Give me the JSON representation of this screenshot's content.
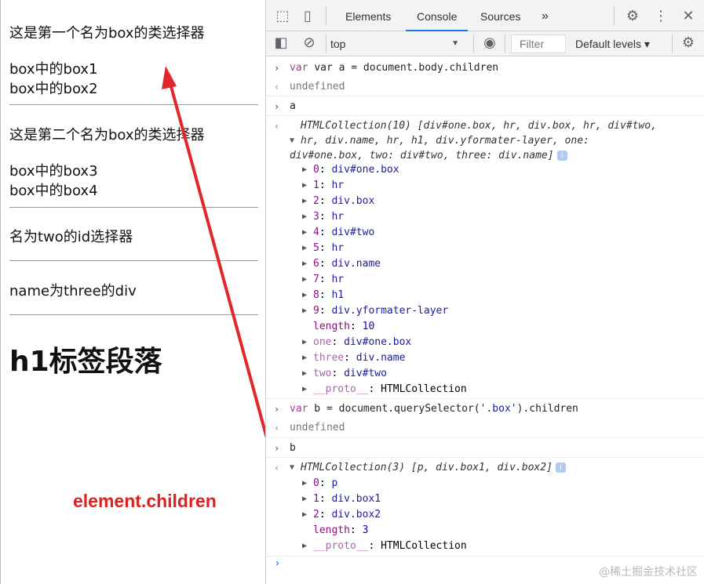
{
  "page": {
    "box1_title": "这是第一个名为box的类选择器",
    "box1_child1": "box中的box1",
    "box1_child2": "box中的box2",
    "box2_title": "这是第二个名为box的类选择器",
    "box2_child1": "box中的box3",
    "box2_child2": "box中的box4",
    "id_two": "名为two的id选择器",
    "name_three": "name为three的div",
    "h1": "h1标签段落",
    "annotation": "element.children"
  },
  "devtools": {
    "tabs": [
      "Elements",
      "Console",
      "Sources"
    ],
    "active_tab": "Console",
    "more_tabs": "»",
    "context": "top",
    "filter_placeholder": "Filter",
    "levels": "Default levels ▾",
    "accent": "#1a73e8"
  },
  "console": {
    "cmd1": "var a = document.body.children",
    "res1": "undefined",
    "cmd2": "a",
    "coll_a_l1": "HTMLCollection(10) [div#one.box, hr, div.box, hr, div#two,",
    "coll_a_l2": "hr, div.name, hr, h1, div.yformater-layer, one:",
    "coll_a_l3": "div#one.box, two: div#two, three: div.name]",
    "a_items": [
      {
        "k": "0",
        "v": "div#one.box"
      },
      {
        "k": "1",
        "v": "hr"
      },
      {
        "k": "2",
        "v": "div.box"
      },
      {
        "k": "3",
        "v": "hr"
      },
      {
        "k": "4",
        "v": "div#two"
      },
      {
        "k": "5",
        "v": "hr"
      },
      {
        "k": "6",
        "v": "div.name"
      },
      {
        "k": "7",
        "v": "hr"
      },
      {
        "k": "8",
        "v": "h1"
      },
      {
        "k": "9",
        "v": "div.yformater-layer"
      }
    ],
    "a_length_key": "length",
    "a_length_val": "10",
    "a_named": [
      {
        "k": "one",
        "v": "div#one.box"
      },
      {
        "k": "three",
        "v": "div.name"
      },
      {
        "k": "two",
        "v": "div#two"
      }
    ],
    "proto_key": "__proto__",
    "proto_val": "HTMLCollection",
    "cmd3": "var b = document.querySelector('.box').children",
    "res3": "undefined",
    "cmd4": "b",
    "coll_b": "HTMLCollection(3) [p, div.box1, div.box2]",
    "b_items": [
      {
        "k": "0",
        "v": "p"
      },
      {
        "k": "1",
        "v": "div.box1"
      },
      {
        "k": "2",
        "v": "div.box2"
      }
    ],
    "b_length_val": "3",
    "prompt": "›",
    "watermark": "@稀土掘金技术社区"
  }
}
